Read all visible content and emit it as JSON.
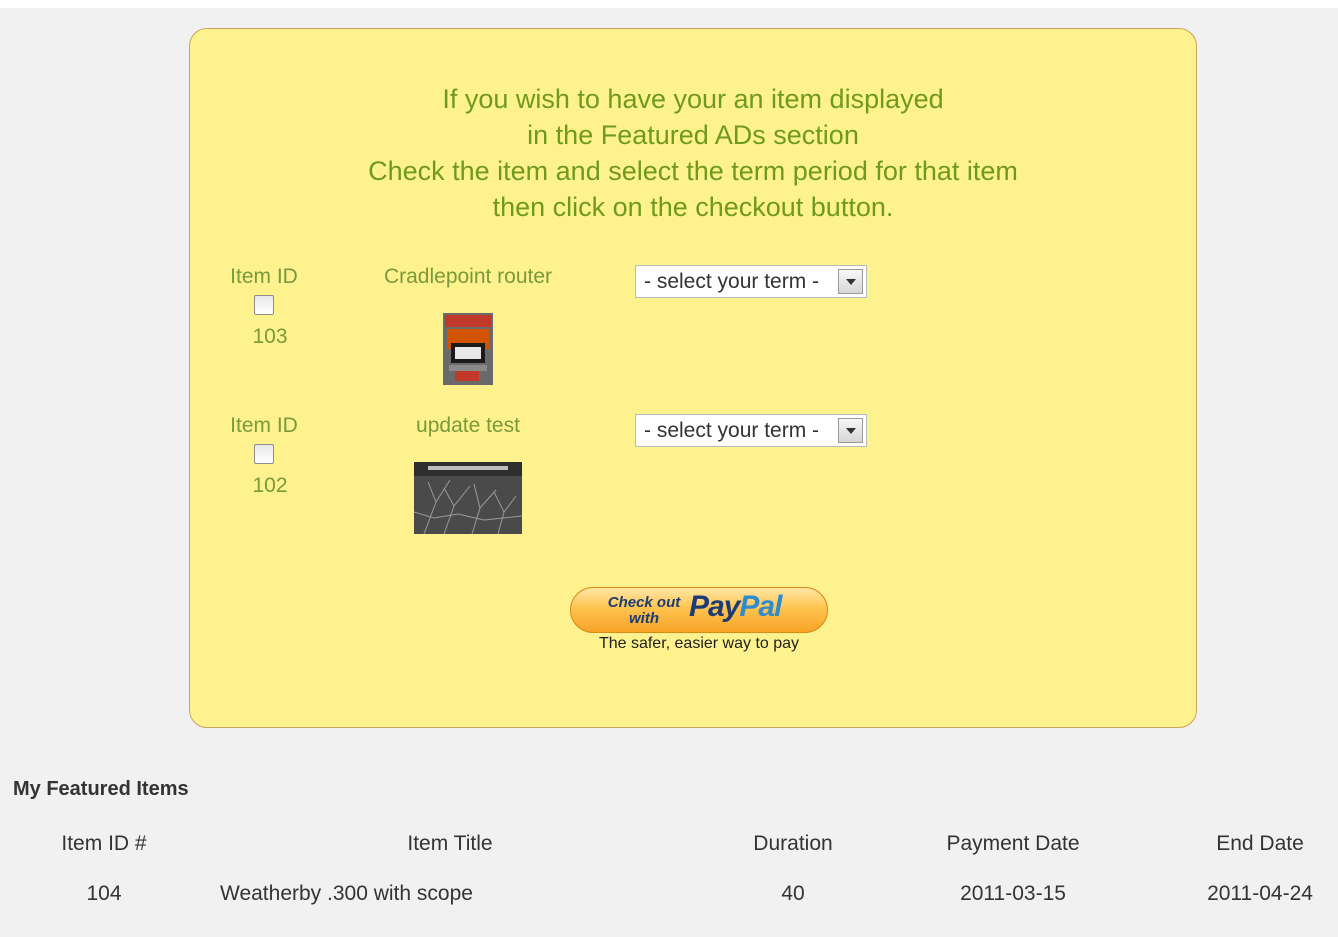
{
  "instructions": {
    "line1": "If you wish to have your an item displayed",
    "line2": "in the Featured ADs section",
    "line3": "Check the item and select the term period for that item",
    "line4": "then click on the checkout button."
  },
  "items": [
    {
      "id_label": "Item ID",
      "id": "103",
      "title": "Cradlepoint router",
      "select_value": "- select your term -"
    },
    {
      "id_label": "Item ID",
      "id": "102",
      "title": "update test",
      "select_value": "- select your term -"
    }
  ],
  "paypal": {
    "checkout_line1": "Check out",
    "checkout_line2": "with",
    "logo_pay": "Pay",
    "logo_pal": "Pal",
    "tagline": "The safer, easier way to pay"
  },
  "featured": {
    "heading": "My Featured Items",
    "columns": [
      "Item ID #",
      "Item Title",
      "Duration",
      "Payment Date",
      "End Date"
    ],
    "rows": [
      {
        "id": "104",
        "title": "Weatherby .300 with scope",
        "duration": "40",
        "payment_date": "2011-03-15",
        "end_date": "2011-04-24"
      }
    ]
  },
  "colors": {
    "panel_bg": "#fef28f",
    "panel_border": "#caa55c",
    "text_green": "#6f9a1e",
    "paypal_orange": "#ffc450",
    "paypal_navy": "#1d3c76",
    "paypal_blue": "#2f8bd0"
  }
}
